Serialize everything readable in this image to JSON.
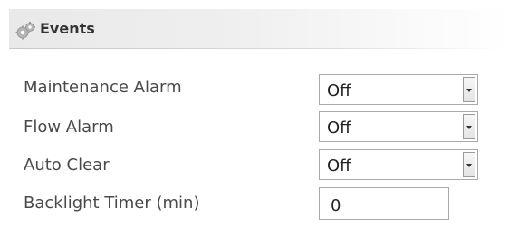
{
  "panel": {
    "title": "Events",
    "icon": "gear-icon"
  },
  "rows": [
    {
      "label": "Maintenance Alarm",
      "control": "select",
      "value": "Off"
    },
    {
      "label": "Flow Alarm",
      "control": "select",
      "value": "Off"
    },
    {
      "label": "Auto Clear",
      "control": "select",
      "value": "Off"
    },
    {
      "label": "Backlight Timer (min)",
      "control": "text",
      "value": "0"
    }
  ]
}
